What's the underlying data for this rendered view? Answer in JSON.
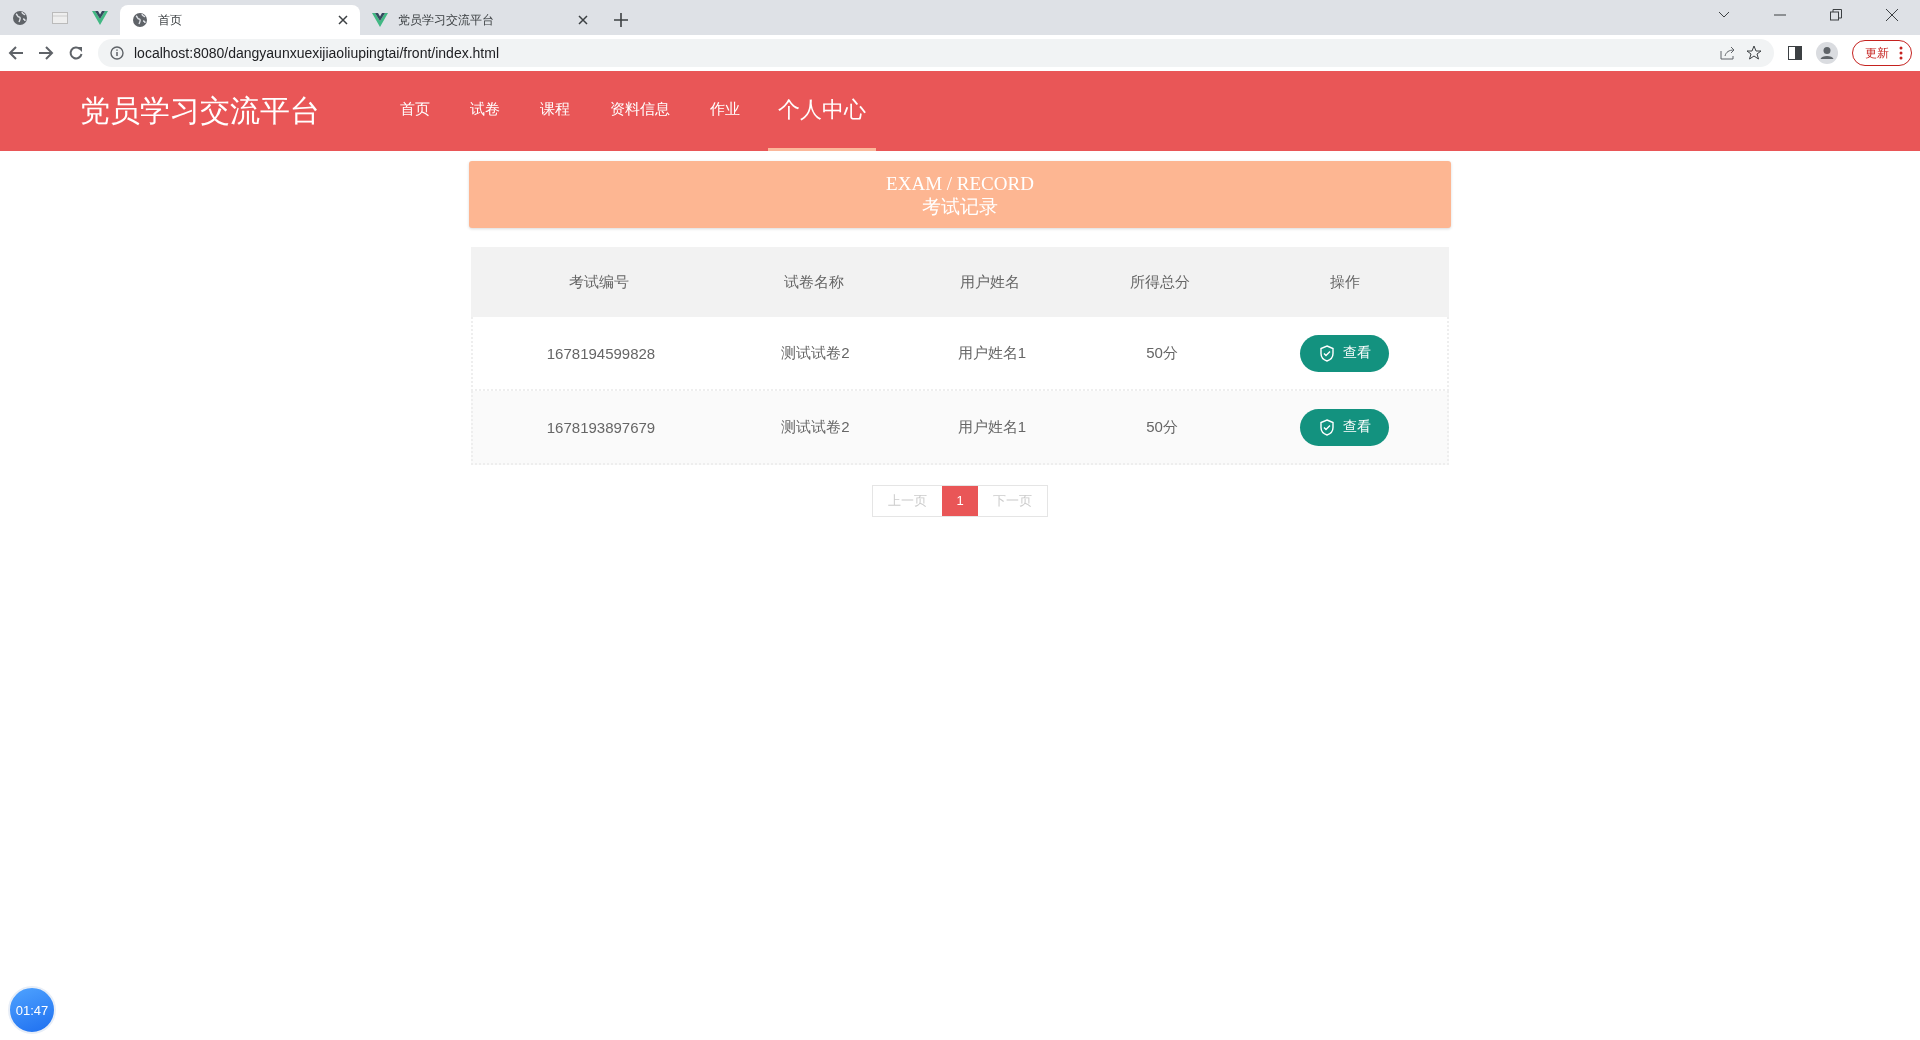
{
  "browser": {
    "tabs": [
      {
        "kind": "site",
        "title": "首页",
        "selected": true
      },
      {
        "kind": "app",
        "title": "党员学习交流平台",
        "selected": false
      }
    ],
    "url": "localhost:8080/dangyaunxuexijiaoliupingtai/front/index.html",
    "update_button": "更新"
  },
  "header": {
    "logo": "党员学习交流平台",
    "nav": [
      {
        "label": "首页",
        "selected": false
      },
      {
        "label": "试卷",
        "selected": false
      },
      {
        "label": "课程",
        "selected": false
      },
      {
        "label": "资料信息",
        "selected": false
      },
      {
        "label": "作业",
        "selected": false
      },
      {
        "label": "个人中心",
        "selected": true
      }
    ]
  },
  "banner": {
    "title_en": "EXAM / RECORD",
    "title_zh": "考试记录"
  },
  "table": {
    "columns": [
      "考试编号",
      "试卷名称",
      "用户姓名",
      "所得总分",
      "操作"
    ],
    "rows": [
      {
        "cells": [
          "1678194599828",
          "测试试卷2",
          "用户姓名1",
          "50分"
        ],
        "action": "查看"
      },
      {
        "cells": [
          "1678193897679",
          "测试试卷2",
          "用户姓名1",
          "50分"
        ],
        "action": "查看"
      }
    ]
  },
  "pagination": {
    "prev": {
      "label": "上一页",
      "disabled": true
    },
    "pages": [
      {
        "label": "1",
        "selected": true
      }
    ],
    "next": {
      "label": "下一页",
      "disabled": true
    }
  },
  "timer": "01:47"
}
